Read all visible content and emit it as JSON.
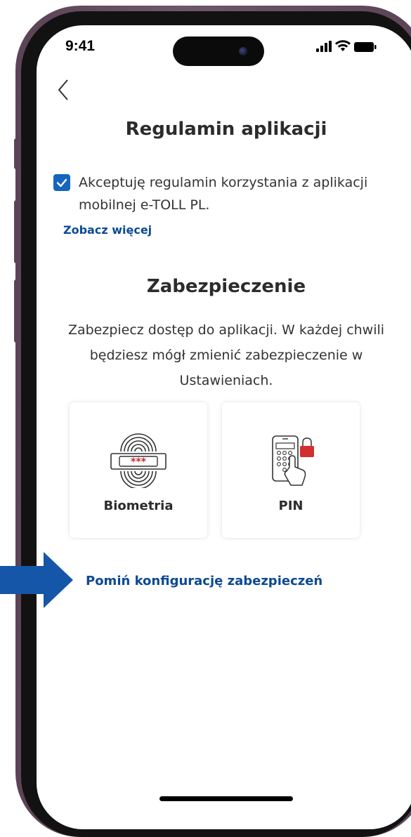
{
  "status_bar": {
    "time": "9:41"
  },
  "nav": {
    "back_icon": "chevron-left-icon"
  },
  "terms": {
    "title": "Regulamin aplikacji",
    "checkbox_checked": true,
    "checkbox_label": "Akceptuję regulamin korzystania z aplikacji mobilnej e-TOLL PL.",
    "see_more": "Zobacz więcej"
  },
  "security": {
    "title": "Zabezpieczenie",
    "description": "Zabezpiecz dostęp do aplikacji. W każdej chwili będziesz mógł zmienić zabezpieczenie w Ustawieniach.",
    "options": [
      {
        "label": "Biometria",
        "icon": "fingerprint-password-icon"
      },
      {
        "label": "PIN",
        "icon": "phone-pin-lock-icon"
      }
    ],
    "skip_label": "Pomiń konfigurację zabezpieczeń"
  },
  "colors": {
    "accent": "#1565c0",
    "link": "#0b4a94",
    "text": "#2c2c2c",
    "frame": "#5b4356",
    "arrow": "#1656a8",
    "lock": "#d32f2f"
  }
}
